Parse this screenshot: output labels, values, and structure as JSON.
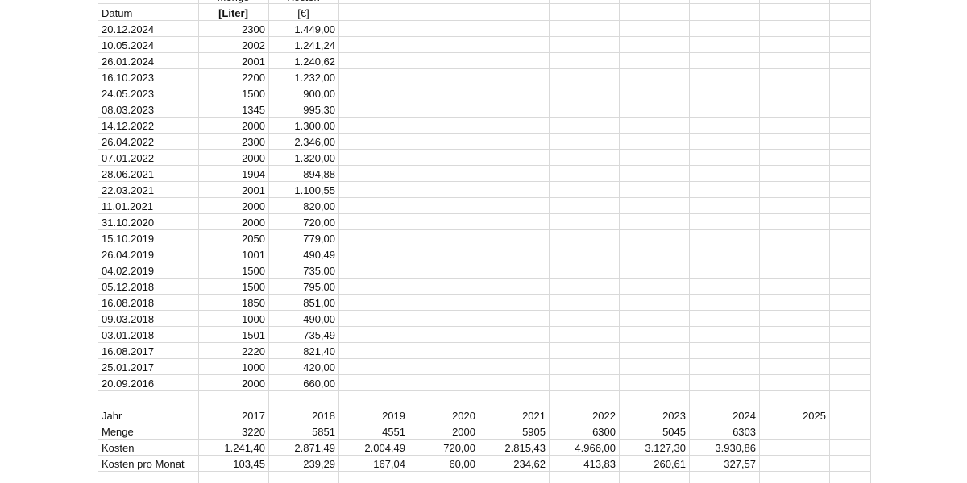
{
  "header": {
    "datum": "Datum",
    "menge_top": "Menge",
    "menge_unit": "[Liter]",
    "kosten_top": "Kosten",
    "kosten_unit": "[€]"
  },
  "deliveries": [
    {
      "datum": "20.12.2024",
      "menge": "2300",
      "kosten": "1.449,00"
    },
    {
      "datum": "10.05.2024",
      "menge": "2002",
      "kosten": "1.241,24"
    },
    {
      "datum": "26.01.2024",
      "menge": "2001",
      "kosten": "1.240,62"
    },
    {
      "datum": "16.10.2023",
      "menge": "2200",
      "kosten": "1.232,00"
    },
    {
      "datum": "24.05.2023",
      "menge": "1500",
      "kosten": "900,00"
    },
    {
      "datum": "08.03.2023",
      "menge": "1345",
      "kosten": "995,30"
    },
    {
      "datum": "14.12.2022",
      "menge": "2000",
      "kosten": "1.300,00"
    },
    {
      "datum": "26.04.2022",
      "menge": "2300",
      "kosten": "2.346,00"
    },
    {
      "datum": "07.01.2022",
      "menge": "2000",
      "kosten": "1.320,00"
    },
    {
      "datum": "28.06.2021",
      "menge": "1904",
      "kosten": "894,88"
    },
    {
      "datum": "22.03.2021",
      "menge": "2001",
      "kosten": "1.100,55"
    },
    {
      "datum": "11.01.2021",
      "menge": "2000",
      "kosten": "820,00"
    },
    {
      "datum": "31.10.2020",
      "menge": "2000",
      "kosten": "720,00"
    },
    {
      "datum": "15.10.2019",
      "menge": "2050",
      "kosten": "779,00"
    },
    {
      "datum": "26.04.2019",
      "menge": "1001",
      "kosten": "490,49"
    },
    {
      "datum": "04.02.2019",
      "menge": "1500",
      "kosten": "735,00"
    },
    {
      "datum": "05.12.2018",
      "menge": "1500",
      "kosten": "795,00"
    },
    {
      "datum": "16.08.2018",
      "menge": "1850",
      "kosten": "851,00"
    },
    {
      "datum": "09.03.2018",
      "menge": "1000",
      "kosten": "490,00"
    },
    {
      "datum": "03.01.2018",
      "menge": "1501",
      "kosten": "735,49"
    },
    {
      "datum": "16.08.2017",
      "menge": "2220",
      "kosten": "821,40"
    },
    {
      "datum": "25.01.2017",
      "menge": "1000",
      "kosten": "420,00"
    },
    {
      "datum": "20.09.2016",
      "menge": "2000",
      "kosten": "660,00"
    }
  ],
  "summary": {
    "labels": {
      "jahr": "Jahr",
      "menge": "Menge",
      "kosten": "Kosten",
      "kosten_pro_monat": "Kosten pro Monat"
    },
    "years": [
      "2017",
      "2018",
      "2019",
      "2020",
      "2021",
      "2022",
      "2023",
      "2024",
      "2025"
    ],
    "menge": [
      "3220",
      "5851",
      "4551",
      "2000",
      "5905",
      "6300",
      "5045",
      "6303",
      ""
    ],
    "kosten": [
      "1.241,40",
      "2.871,49",
      "2.004,49",
      "720,00",
      "2.815,43",
      "4.966,00",
      "3.127,30",
      "3.930,86",
      ""
    ],
    "kosten_pro_monat": [
      "103,45",
      "239,29",
      "167,04",
      "60,00",
      "234,62",
      "413,83",
      "260,61",
      "327,57",
      ""
    ]
  }
}
